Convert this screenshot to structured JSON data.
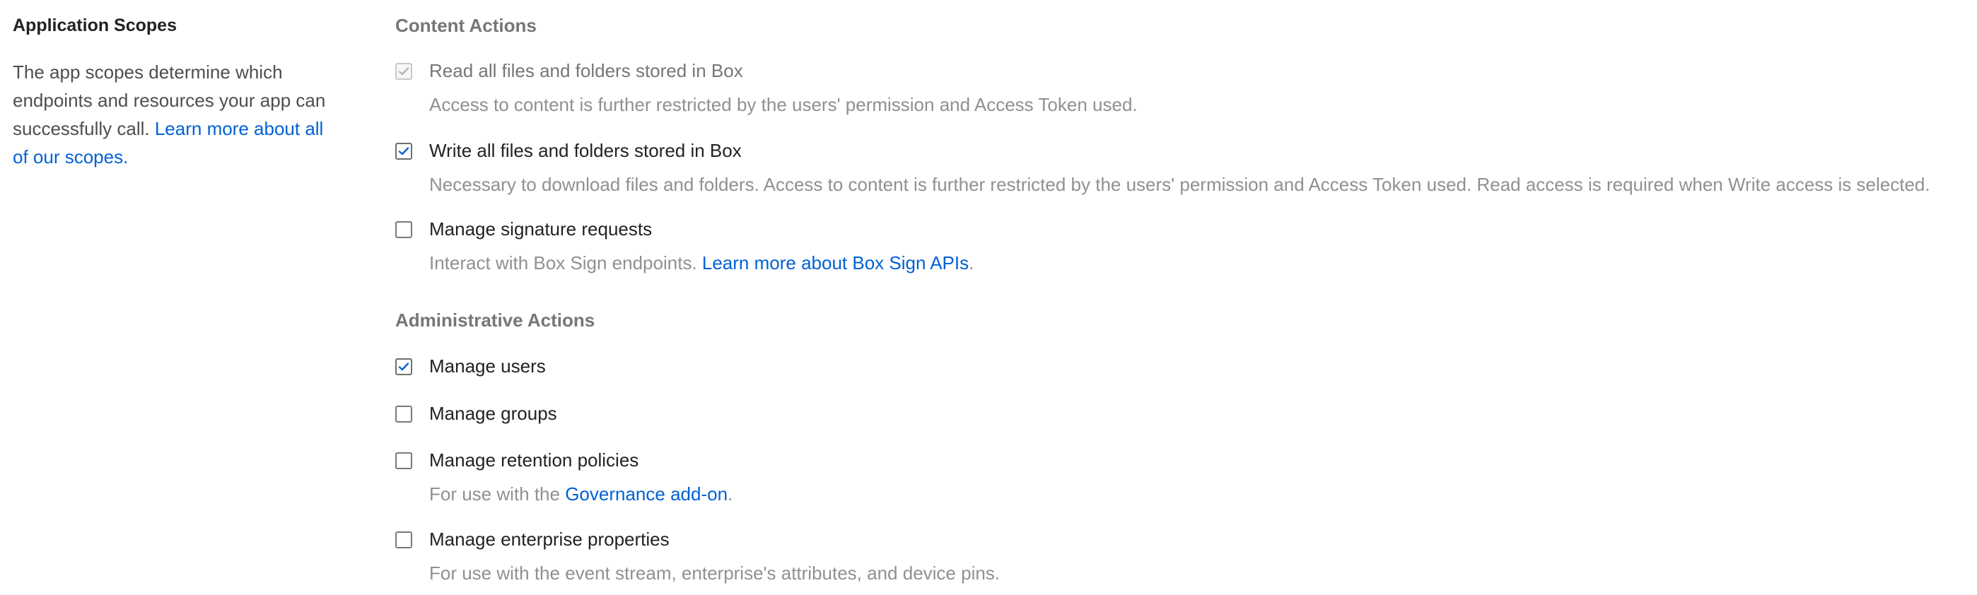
{
  "left": {
    "title": "Application Scopes",
    "desc_text": "The app scopes determine which endpoints and resources your app can successfully call. ",
    "desc_link": "Learn more about all of our scopes."
  },
  "content_actions": {
    "title": "Content Actions",
    "read": {
      "label": "Read all files and folders stored in Box",
      "help": "Access to content is further restricted by the users' permission and Access Token used.",
      "checked": true,
      "disabled": true
    },
    "write": {
      "label": "Write all files and folders stored in Box",
      "help": "Necessary to download files and folders. Access to content is further restricted by the users' permission and Access Token used. Read access is required when Write access is selected.",
      "checked": true
    },
    "sign": {
      "label": "Manage signature requests",
      "help_text": "Interact with Box Sign endpoints. ",
      "help_link": "Learn more about Box Sign APIs",
      "help_suffix": ".",
      "checked": false
    }
  },
  "admin_actions": {
    "title": "Administrative Actions",
    "users": {
      "label": "Manage users",
      "checked": true
    },
    "groups": {
      "label": "Manage groups",
      "checked": false
    },
    "retention": {
      "label": "Manage retention policies",
      "help_text": "For use with the ",
      "help_link": "Governance add-on",
      "help_suffix": ".",
      "checked": false
    },
    "enterprise": {
      "label": "Manage enterprise properties",
      "help": "For use with the event stream, enterprise's attributes, and device pins.",
      "checked": false
    }
  },
  "colors": {
    "link": "#0061d5",
    "checkmark": "#0061d5",
    "section_title": "#767676",
    "help_text": "#909090"
  }
}
